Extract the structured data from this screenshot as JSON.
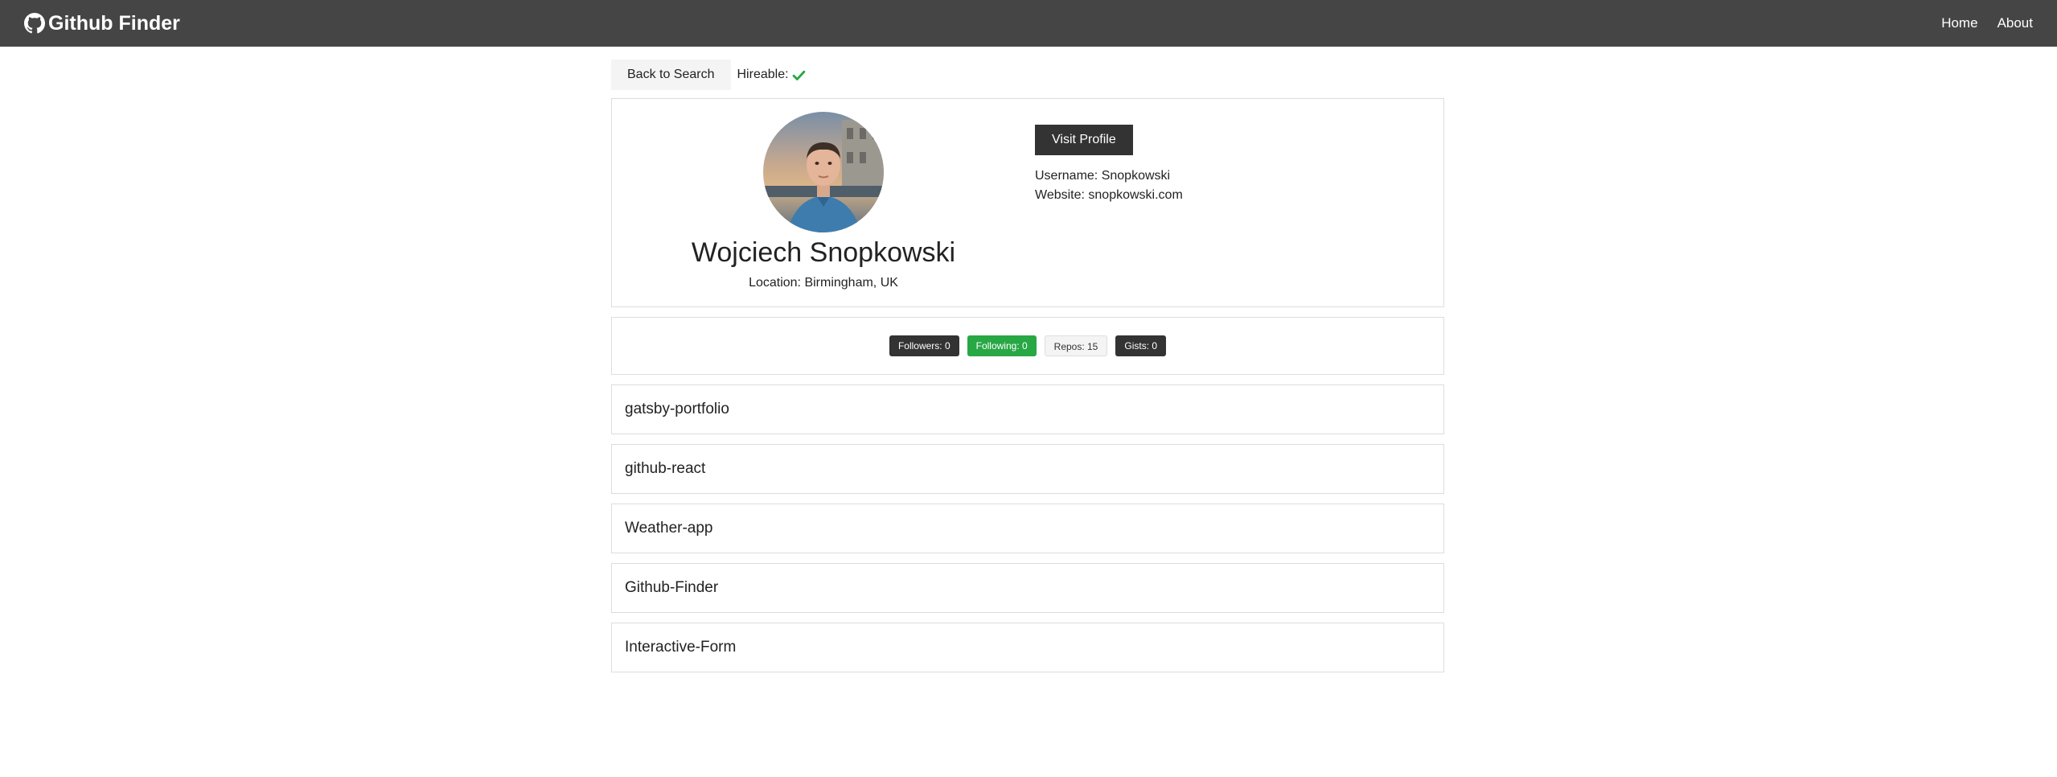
{
  "navbar": {
    "brand": "Github Finder",
    "links": [
      "Home",
      "About"
    ]
  },
  "toolbar": {
    "back_label": "Back to Search",
    "hireable_label": "Hireable:"
  },
  "profile": {
    "name": "Wojciech Snopkowski",
    "location": "Location: Birmingham, UK",
    "visit_label": "Visit Profile",
    "username": "Username: Snopkowski",
    "website": "Website: snopkowski.com"
  },
  "stats": {
    "followers": "Followers: 0",
    "following": "Following: 0",
    "repos": "Repos: 15",
    "gists": "Gists: 0"
  },
  "repos": [
    "gatsby-portfolio",
    "github-react",
    "Weather-app",
    "Github-Finder",
    "Interactive-Form"
  ],
  "colors": {
    "navbar": "#454545",
    "dark": "#333333",
    "success": "#28a745",
    "light": "#f4f4f4"
  }
}
